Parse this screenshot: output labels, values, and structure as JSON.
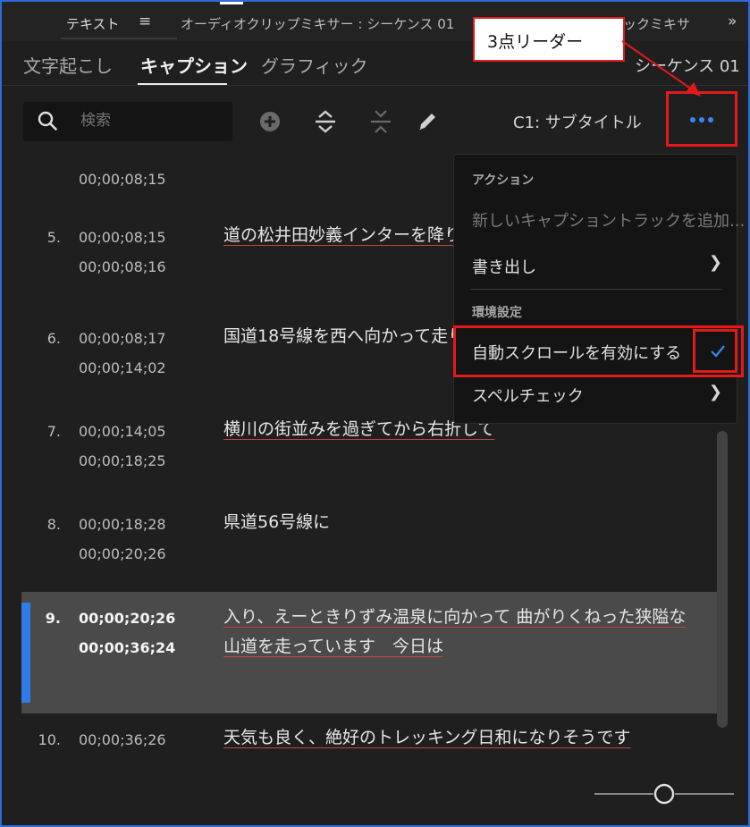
{
  "panel_tabs": {
    "text": "テキスト",
    "menu_glyph": "≡",
    "mixer": "オーディオクリップミキサー : シーケンス 01",
    "mixer2": "ックミキサ",
    "more": "»"
  },
  "subtabs": {
    "transcribe": "文字起こし",
    "captions": "キャプション",
    "graphics": "グラフィック",
    "sequence": "シーケンス 01"
  },
  "toolbar": {
    "search_placeholder": "検索",
    "track": "C1: サブタイトル"
  },
  "captions": [
    {
      "num": "",
      "in": "",
      "out": "00;00;08;15",
      "text": "",
      "partial": true
    },
    {
      "num": "5.",
      "in": "00;00;08;15",
      "out": "00;00;08;16",
      "text": "道の松井田妙義インターを降り"
    },
    {
      "num": "6.",
      "in": "00;00;08;17",
      "out": "00;00;14;02",
      "text": "国道18号線を西へ向かって走り"
    },
    {
      "num": "7.",
      "in": "00;00;14;05",
      "out": "00;00;18;25",
      "text": "横川の街並みを過ぎてから右折して"
    },
    {
      "num": "8.",
      "in": "00;00;18;28",
      "out": "00;00;20;26",
      "text": "県道56号線に"
    },
    {
      "num": "9.",
      "in": "00;00;20;26",
      "out": "00;00;36;24",
      "text": "入り、えーときりずみ温泉に向かって 曲がりくねった狭隘な山道を走っています　今日は"
    },
    {
      "num": "10.",
      "in": "00;00;36;26",
      "out": "",
      "text": "天気も良く、絶好のトレッキング日和になりそうです"
    }
  ],
  "menu": {
    "section_action": "アクション",
    "add_track": "新しいキャプショントラックを追加...",
    "export": "書き出し",
    "section_prefs": "環境設定",
    "auto_scroll": "自動スクロールを有効にする",
    "spell_check": "スペルチェック",
    "auto_scroll_checked": true
  },
  "annotation": {
    "callout": "3点リーダー"
  },
  "colors": {
    "accent": "#2f7be8",
    "annotation_red": "#e21a1a",
    "underline_red": "#c0463c"
  },
  "icons": [
    "search-icon",
    "add-caption-icon",
    "split-caption-icon",
    "merge-caption-icon",
    "edit-icon",
    "more-dots-icon",
    "chevron-right-icon",
    "checkmark-icon"
  ]
}
